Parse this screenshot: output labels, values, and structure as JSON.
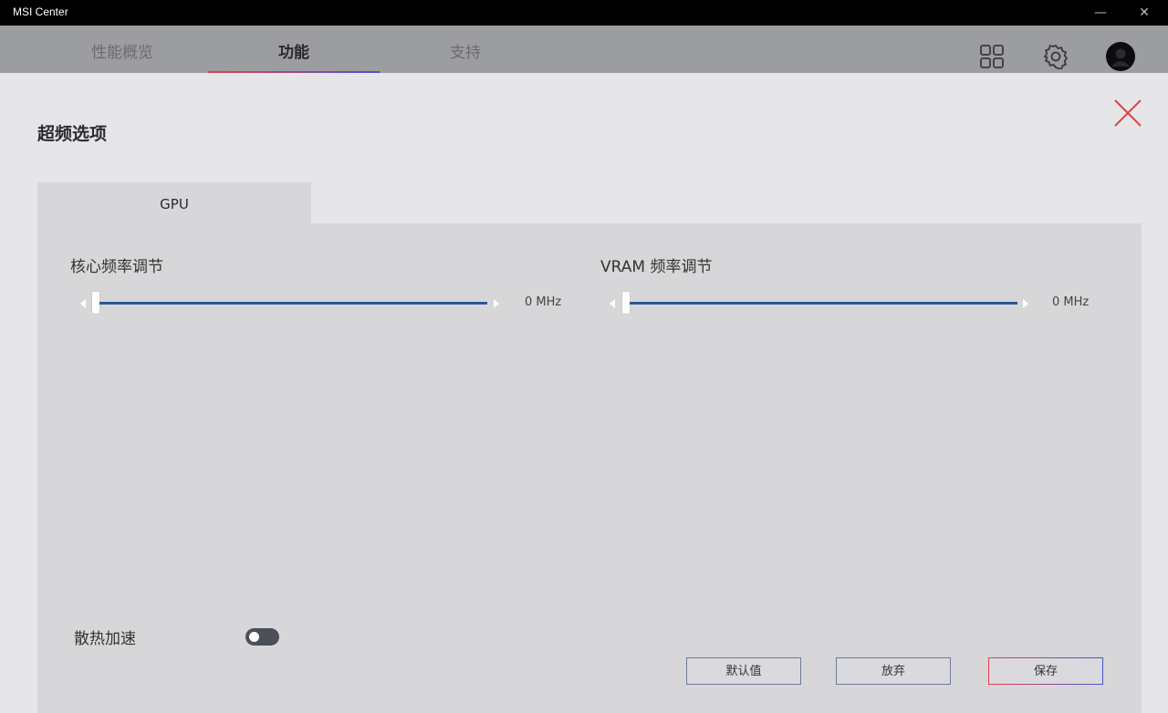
{
  "window": {
    "title": "MSI Center",
    "minimize_glyph": "—",
    "close_glyph": "✕"
  },
  "nav": {
    "tabs": [
      {
        "label": "性能概览"
      },
      {
        "label": "功能"
      },
      {
        "label": "支持"
      }
    ],
    "active_tab": "功能",
    "icons": [
      "grid-icon",
      "gear-icon",
      "avatar"
    ]
  },
  "page": {
    "title": "超频选项",
    "active_subtab": "GPU"
  },
  "sliders": {
    "core": {
      "label": "核心频率调节",
      "value": 0,
      "value_text": "0 MHz"
    },
    "vram": {
      "label": "VRAM 频率调节",
      "value": 0,
      "value_text": "0 MHz"
    }
  },
  "fan_boost": {
    "label": "散热加速",
    "enabled": false
  },
  "buttons": {
    "default": "默认值",
    "discard": "放弃",
    "save": "保存"
  },
  "colors": {
    "accent_red": "#e8404a",
    "accent_blue": "#4a52d0",
    "slider_track": "#2d5799",
    "close_red": "#e0404a"
  }
}
